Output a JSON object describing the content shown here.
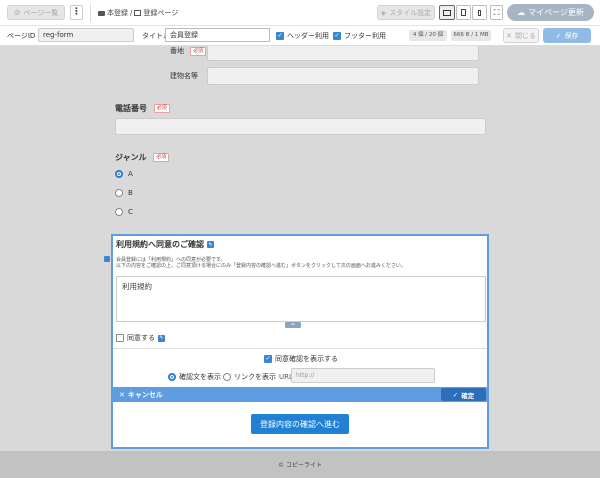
{
  "toolbar": {
    "page_list_label": "ページ一覧",
    "breadcrumb_parent": "本登録",
    "breadcrumb_separator": "/",
    "breadcrumb_current": "登録ページ",
    "style_settings_label": "スタイル設定",
    "my_page_update_label": "マイページ更新"
  },
  "settings_bar": {
    "page_id_label": "ページID",
    "page_id_value": "reg-form",
    "title_label": "タイトル",
    "title_value": "会員登録",
    "use_header_label": "ヘッダー利用",
    "use_footer_label": "フッター利用",
    "count_badge": "4 個 / 20 個",
    "size_badge": "666 B / 1 MB",
    "close_label": "閉じる",
    "save_label": "保存"
  },
  "form": {
    "address_label": "番地",
    "building_label": "建物名等",
    "required_badge": "必須",
    "phone_label": "電話番号",
    "genre_label": "ジャンル",
    "genre_options": [
      "A",
      "B",
      "C"
    ],
    "genre_selected": "A",
    "submit_label": "登録内容の確認へ進む"
  },
  "consent_panel": {
    "title": "利用規約へ同意のご確認",
    "description_line1": "会員登録には「利用規約」への同意が必要です。",
    "description_line2": "以下の内容をご確認の上、ご同意頂ける場合にのみ「登録内容の確認へ進む」ボタンをクリックして次の画面へお進みください。",
    "terms_text": "利用規約",
    "agree_label": "同意する",
    "show_confirm_label": "同意確認を表示する",
    "option_text_label": "確認文を表示",
    "option_link_label": "リンクを表示",
    "url_label": "URL",
    "url_placeholder": "http://",
    "cancel_label": "キャンセル",
    "confirm_label": "確定"
  },
  "footer": {
    "copyright": "© コピーライト"
  },
  "colors": {
    "accent_blue": "#3a86d0",
    "panel_footer_blue": "#5e9de0",
    "confirm_button": "#2c6fb8",
    "submit_button": "#2180d3",
    "required_red": "#cc3333"
  }
}
